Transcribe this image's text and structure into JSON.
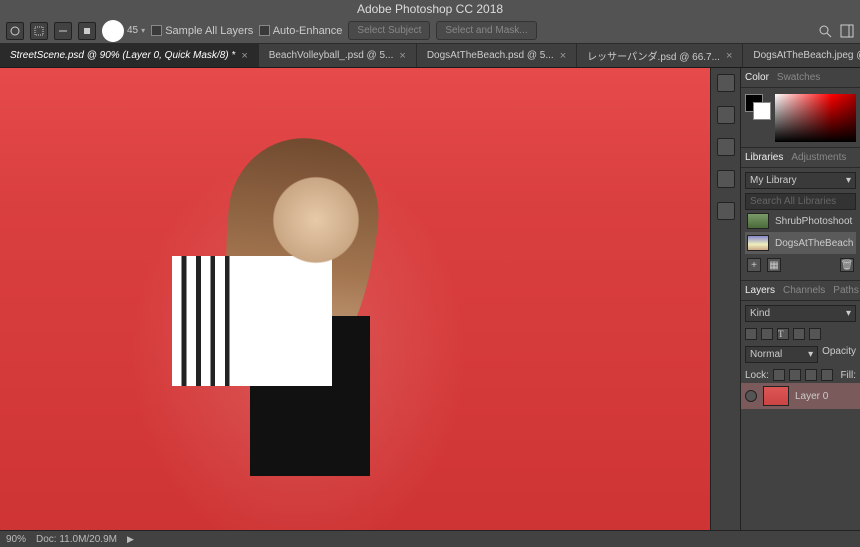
{
  "app_title": "Adobe Photoshop CC 2018",
  "options_bar": {
    "brush_size": "45",
    "sample_all_layers": "Sample All Layers",
    "auto_enhance": "Auto-Enhance",
    "select_subject": "Select Subject",
    "select_and_mask": "Select and Mask..."
  },
  "tabs": [
    {
      "label": "StreetScene.psd @ 90% (Layer 0, Quick Mask/8) *",
      "active": true
    },
    {
      "label": "BeachVolleyball_.psd @ 5...",
      "active": false
    },
    {
      "label": "DogsAtTheBeach.psd @ 5...",
      "active": false
    },
    {
      "label": "レッサーパンダ.psd @ 66.7...",
      "active": false
    },
    {
      "label": "DogsAtTheBeach.jpeg @ ...",
      "active": false
    }
  ],
  "color_panel": {
    "tab1": "Color",
    "tab2": "Swatches"
  },
  "libraries_panel": {
    "tab1": "Libraries",
    "tab2": "Adjustments",
    "dropdown": "My Library",
    "search_placeholder": "Search All Libraries",
    "items": [
      {
        "label": "ShrubPhotoshoot",
        "sel": false
      },
      {
        "label": "DogsAtTheBeach",
        "sel": true
      }
    ]
  },
  "layers_panel": {
    "tab1": "Layers",
    "tab2": "Channels",
    "tab3": "Paths",
    "kind": "Kind",
    "blend": "Normal",
    "opacity": "Opacity",
    "lock": "Lock:",
    "fill": "Fill:",
    "layer0": "Layer 0"
  },
  "status": {
    "zoom": "90%",
    "doc": "Doc: 11.0M/20.9M"
  }
}
